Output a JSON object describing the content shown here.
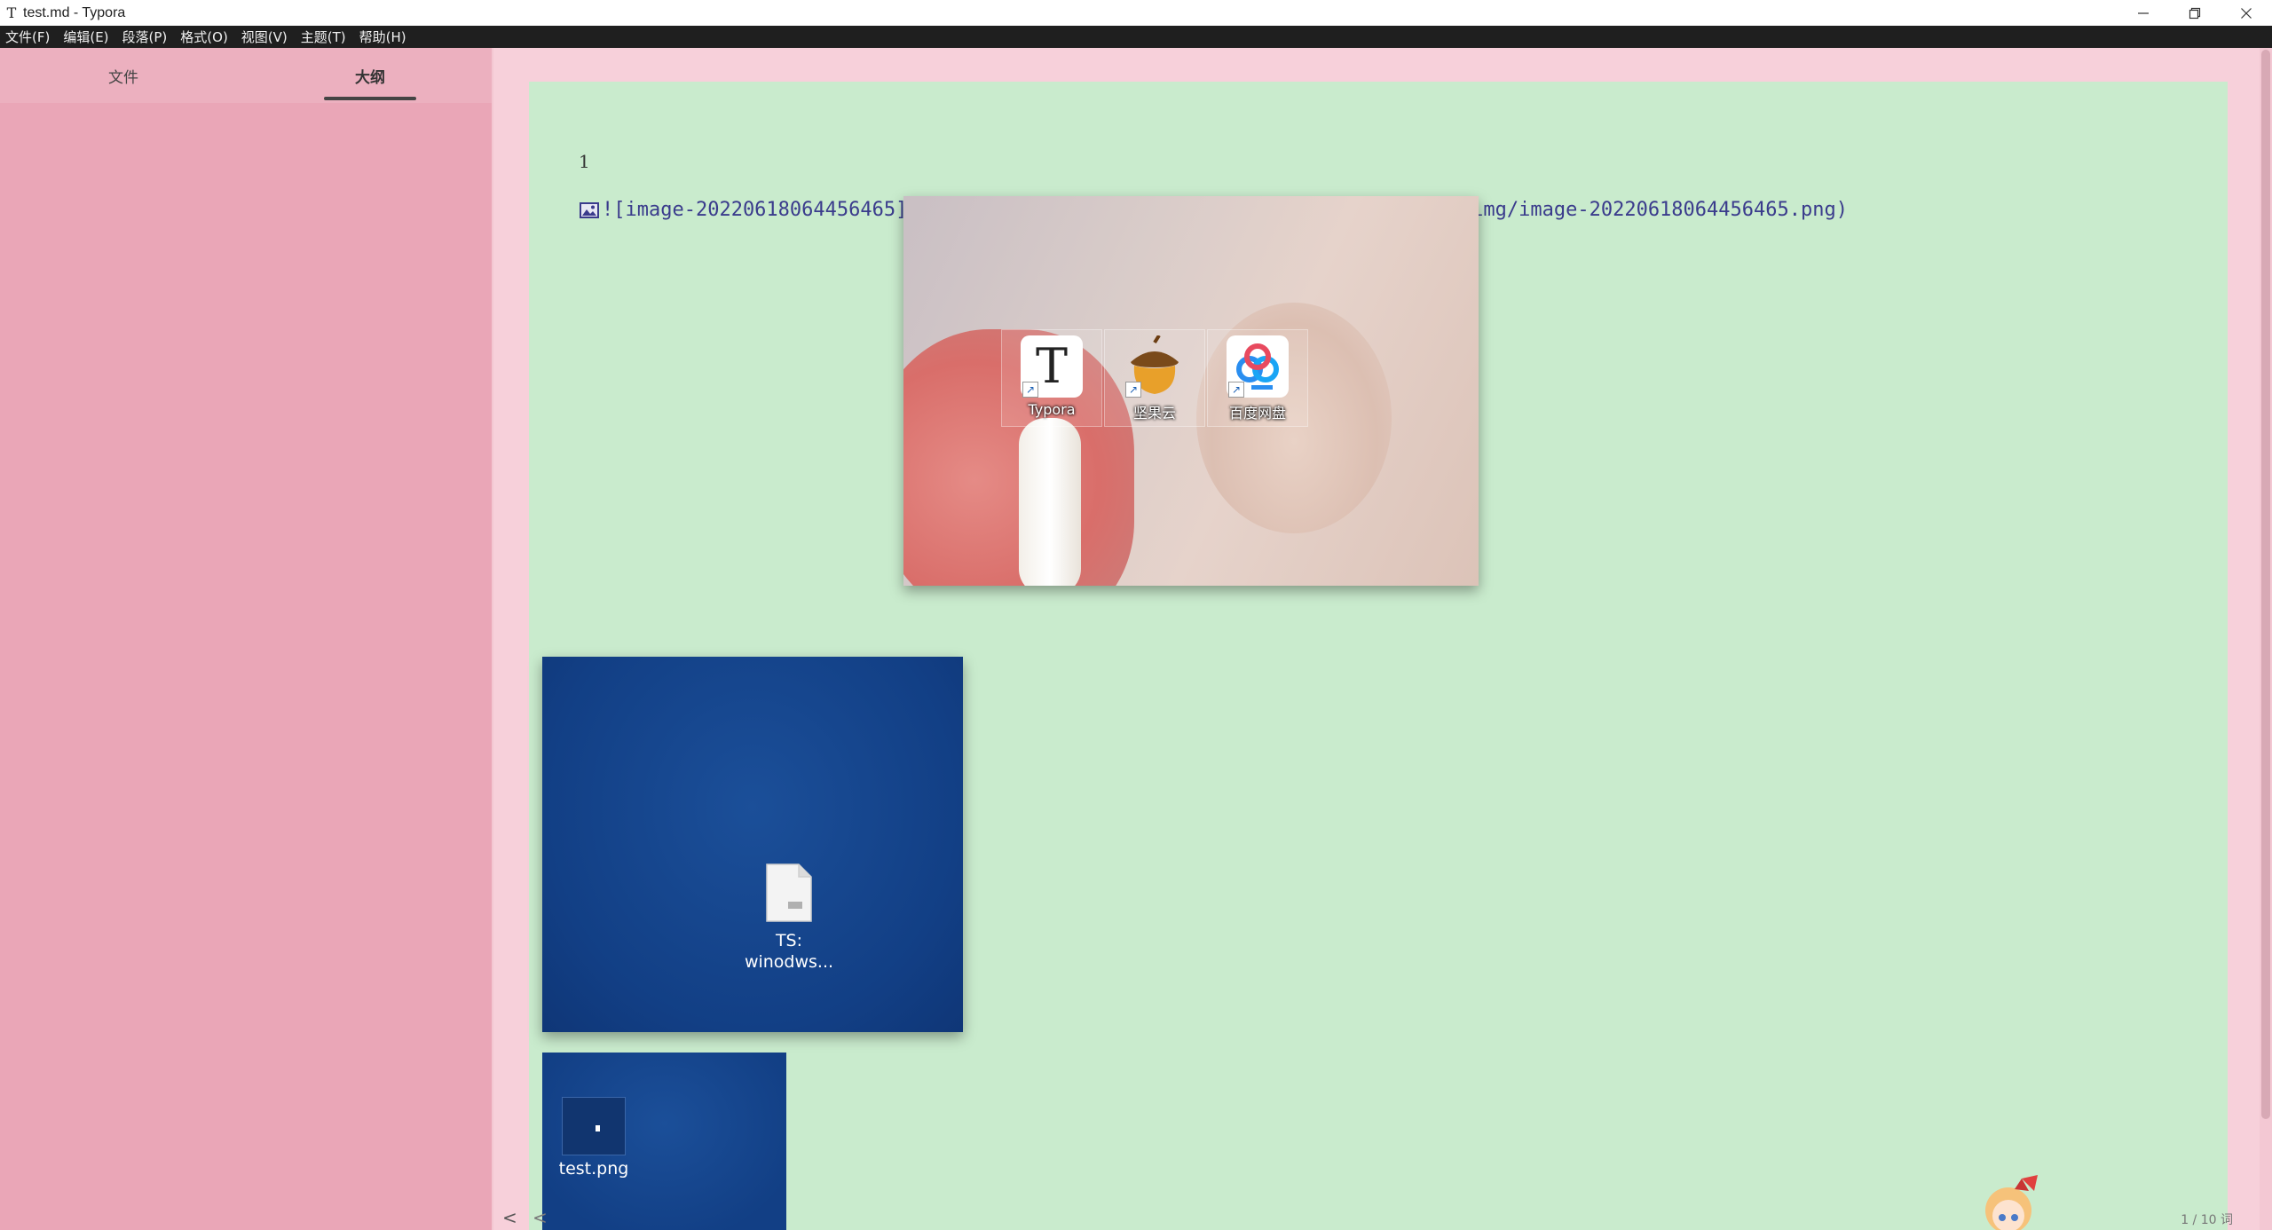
{
  "window": {
    "app_glyph": "T",
    "title": "test.md - Typora"
  },
  "menu": [
    "文件(F)",
    "编辑(E)",
    "段落(P)",
    "格式(O)",
    "视图(V)",
    "主题(T)",
    "帮助(H)"
  ],
  "sidebar": {
    "tabs": [
      {
        "label": "文件",
        "active": false
      },
      {
        "label": "大纲",
        "active": true
      }
    ]
  },
  "editor": {
    "paragraph": "1",
    "image_markdown": "![image-20220618064456465](https://bucket-hg.oss-cn-shanghai.aliyuncs.com/img/image-20220618064456465.png)",
    "preview1_icons": [
      {
        "label": "Typora",
        "icon": "typora-icon"
      },
      {
        "label": "坚果云",
        "icon": "acorn-icon"
      },
      {
        "label": "百度网盘",
        "icon": "baidu-netdisk-icon"
      }
    ],
    "preview2_file_label_line1": "TS:",
    "preview2_file_label_line2": "winodws...",
    "preview3_file_label": "test.png"
  },
  "status": {
    "word_count": "1 / 10 词",
    "nav_prev": "<",
    "nav_prev2": "<"
  },
  "colors": {
    "sidebar_bg": "#eaa6b7",
    "editor_bg": "#c9ebcd",
    "outer_bg": "#f7d0da",
    "markdown_link": "#3a3b8c",
    "menubar_bg": "#1f1f1f"
  }
}
